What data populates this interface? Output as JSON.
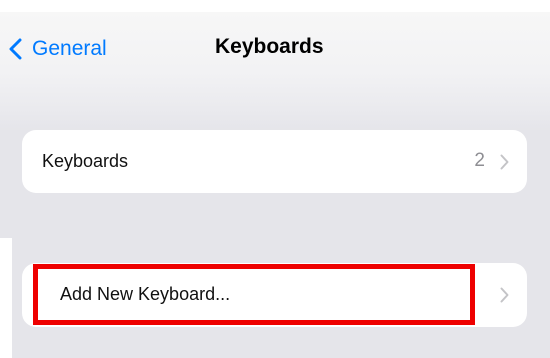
{
  "nav": {
    "back_label": "General",
    "title": "Keyboards"
  },
  "keyboards_row": {
    "label": "Keyboards",
    "count": "2"
  },
  "add_row": {
    "label": "Add New Keyboard..."
  },
  "colors": {
    "accent": "#007aff",
    "highlight": "#ee0000",
    "grouped_background": "#e5e5ea",
    "secondary_text": "#8e8e93"
  },
  "icons": {
    "back": "chevron-left-icon",
    "disclosure": "chevron-right-icon"
  }
}
